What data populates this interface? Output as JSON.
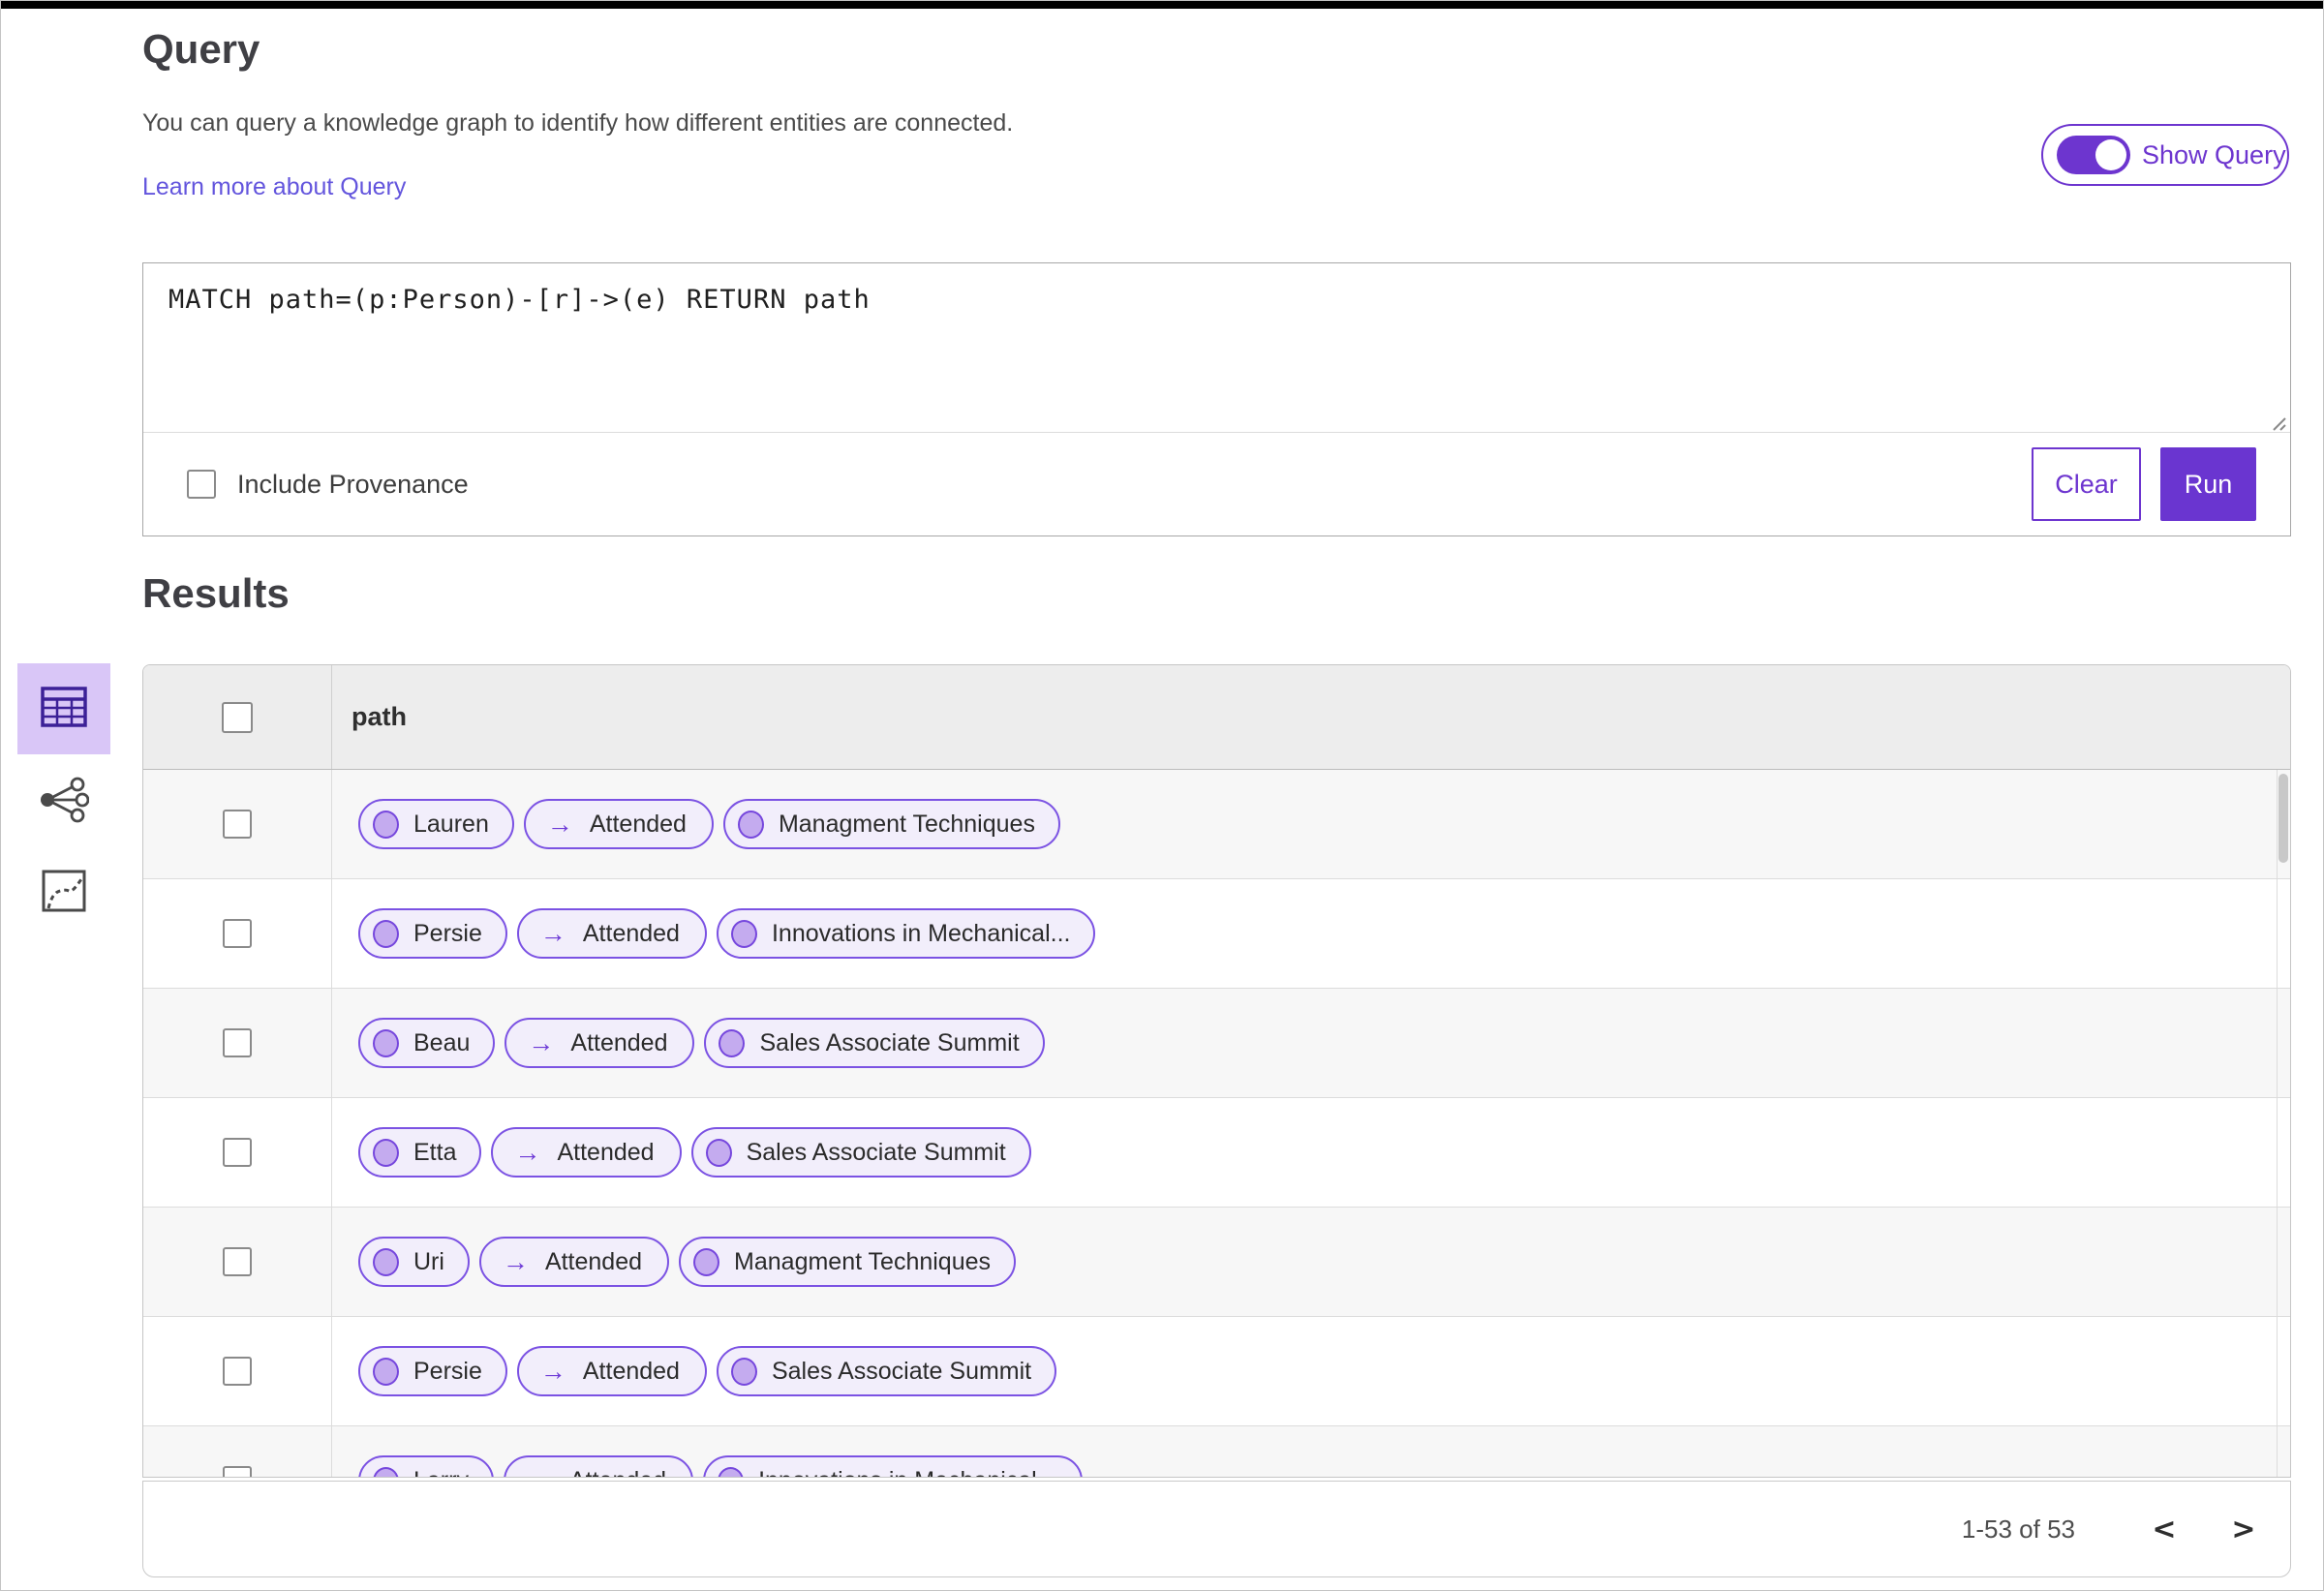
{
  "header": {
    "title": "Query",
    "description": "You can query a knowledge graph to identify how different entities are connected.",
    "learn_more_link": "Learn more about Query",
    "show_query_toggle": {
      "label": "Show Query",
      "state": "on"
    }
  },
  "query_editor": {
    "query_text": "MATCH path=(p:Person)-[r]->(e) RETURN path",
    "include_provenance": {
      "label": "Include Provenance",
      "checked": false
    },
    "clear_button": "Clear",
    "run_button": "Run"
  },
  "results": {
    "heading": "Results",
    "view_switcher": [
      {
        "name": "table-view",
        "icon": "table-icon",
        "selected": true
      },
      {
        "name": "graph-view",
        "icon": "network-icon",
        "selected": false
      },
      {
        "name": "chart-view",
        "icon": "chart-icon",
        "selected": false
      }
    ],
    "table": {
      "column_header": "path",
      "select_all_checked": false,
      "edge_arrow": "→",
      "rows": [
        {
          "checked": false,
          "path": [
            {
              "kind": "node",
              "label": "Lauren"
            },
            {
              "kind": "edge",
              "label": "Attended"
            },
            {
              "kind": "node",
              "label": "Managment Techniques"
            }
          ]
        },
        {
          "checked": false,
          "path": [
            {
              "kind": "node",
              "label": "Persie"
            },
            {
              "kind": "edge",
              "label": "Attended"
            },
            {
              "kind": "node",
              "label": "Innovations in Mechanical..."
            }
          ]
        },
        {
          "checked": false,
          "path": [
            {
              "kind": "node",
              "label": "Beau"
            },
            {
              "kind": "edge",
              "label": "Attended"
            },
            {
              "kind": "node",
              "label": "Sales Associate Summit"
            }
          ]
        },
        {
          "checked": false,
          "path": [
            {
              "kind": "node",
              "label": "Etta"
            },
            {
              "kind": "edge",
              "label": "Attended"
            },
            {
              "kind": "node",
              "label": "Sales Associate Summit"
            }
          ]
        },
        {
          "checked": false,
          "path": [
            {
              "kind": "node",
              "label": "Uri"
            },
            {
              "kind": "edge",
              "label": "Attended"
            },
            {
              "kind": "node",
              "label": "Managment Techniques"
            }
          ]
        },
        {
          "checked": false,
          "path": [
            {
              "kind": "node",
              "label": "Persie"
            },
            {
              "kind": "edge",
              "label": "Attended"
            },
            {
              "kind": "node",
              "label": "Sales Associate Summit"
            }
          ]
        },
        {
          "checked": false,
          "path": [
            {
              "kind": "node",
              "label": "Larry"
            },
            {
              "kind": "edge",
              "label": "Attended"
            },
            {
              "kind": "node",
              "label": "Innovations in Mechanical..."
            }
          ]
        }
      ]
    },
    "pagination": {
      "range_label": "1-53 of 53",
      "prev_icon": "<",
      "next_icon": ">"
    }
  },
  "colors": {
    "accent_purple": "#6d35cf",
    "pill_border": "#7b52e3",
    "pill_background": "#f2eefb",
    "node_dot_fill": "#c4abef",
    "selected_view_background": "#d9c6f7",
    "table_header_background": "#ededed",
    "row_alt_background": "#f7f7f7"
  }
}
